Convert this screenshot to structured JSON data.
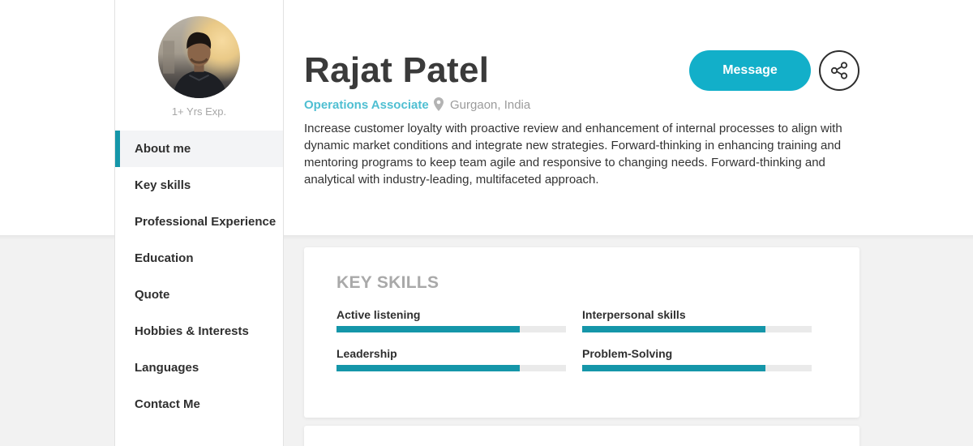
{
  "profile": {
    "experience": "1+ Yrs Exp.",
    "name": "Rajat Patel",
    "title": "Operations Associate",
    "location": "Gurgaon, India",
    "bio": "Increase customer loyalty with proactive review and enhancement of internal processes to align with dynamic market conditions and integrate new strategies. Forward-thinking in enhancing training and mentoring programs to keep team agile and responsive to changing needs. Forward-thinking and analytical with industry-leading, multifaceted approach."
  },
  "actions": {
    "message_label": "Message",
    "share_icon": "share-icon"
  },
  "nav": {
    "items": [
      {
        "label": "About me",
        "active": true
      },
      {
        "label": "Key skills",
        "active": false
      },
      {
        "label": "Professional Experience",
        "active": false
      },
      {
        "label": "Education",
        "active": false
      },
      {
        "label": "Quote",
        "active": false
      },
      {
        "label": "Hobbies & Interests",
        "active": false
      },
      {
        "label": "Languages",
        "active": false
      },
      {
        "label": "Contact Me",
        "active": false
      }
    ]
  },
  "skills": {
    "heading": "KEY SKILLS",
    "items": [
      {
        "label": "Active listening",
        "level": 0.8
      },
      {
        "label": "Interpersonal skills",
        "level": 0.8
      },
      {
        "label": "Leadership",
        "level": 0.8
      },
      {
        "label": "Problem-Solving",
        "level": 0.8
      }
    ]
  },
  "colors": {
    "accent": "#1596a9",
    "button": "#12afc9",
    "title": "#4fbfd2"
  }
}
